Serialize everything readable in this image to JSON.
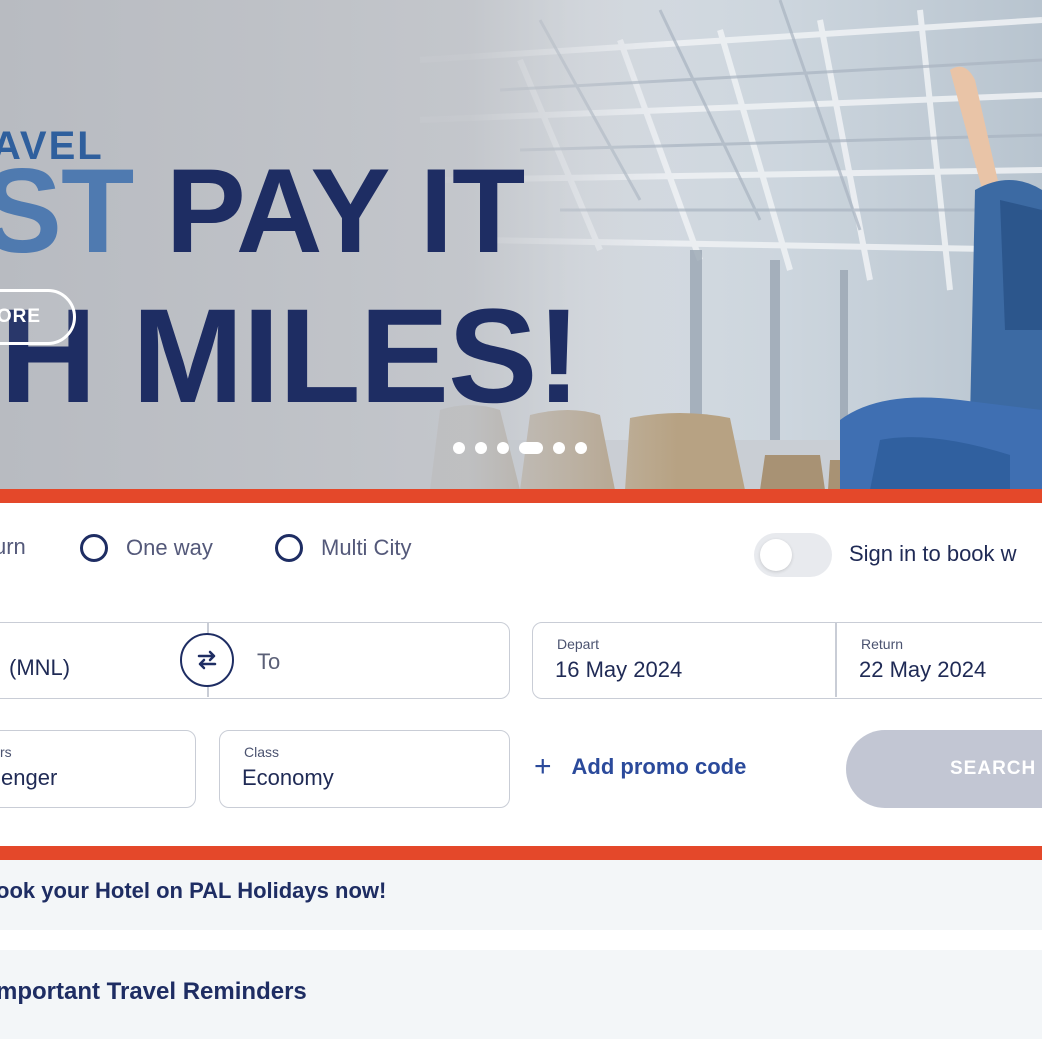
{
  "hero": {
    "title_small": "AVEL",
    "title_line1_fade": "ST",
    "title_line1": "PAY IT",
    "title_line2": "H MILES!",
    "more_button": "ORE",
    "dots_count": 6,
    "active_dot": 4
  },
  "trip_types": {
    "round_trip_partial": "urn",
    "one_way": "One way",
    "multi_city": "Multi City"
  },
  "sign_in": {
    "label": "Sign in to book w"
  },
  "route": {
    "from_value": "(MNL)",
    "to_placeholder": "To"
  },
  "dates": {
    "depart_label": "Depart",
    "depart_value": "16 May 2024",
    "return_label": "Return",
    "return_value": "22 May 2024"
  },
  "passengers": {
    "label_partial": "rs",
    "value_partial": "enger"
  },
  "class": {
    "label": "Class",
    "value": "Economy"
  },
  "promo": {
    "plus": "+",
    "label": "Add promo code"
  },
  "search": {
    "label": "SEARCH"
  },
  "banners": {
    "hotel": "ook your Hotel on PAL Holidays now!",
    "reminders": "mportant Travel Reminders"
  },
  "colors": {
    "brand_navy": "#1e2d63",
    "accent_red": "#e4482a",
    "search_disabled": "#c2c6d3"
  }
}
